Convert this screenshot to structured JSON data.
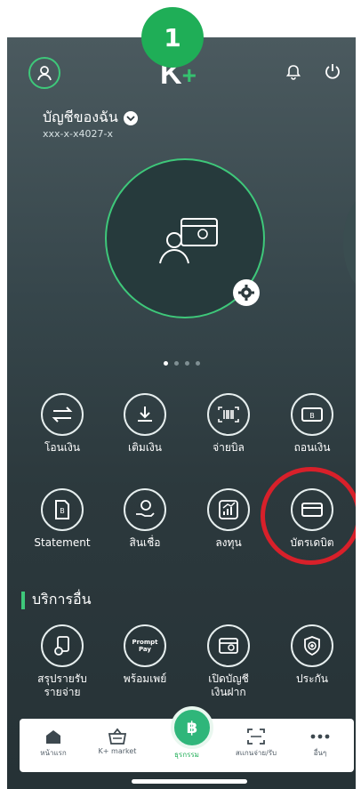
{
  "step_badge": "1",
  "header": {
    "logo_text": "K",
    "logo_plus": "+",
    "account_title": "บัญชีของฉัน",
    "account_number": "xxx-x-x4027-x"
  },
  "carousel": {
    "pages": 4,
    "active": 0
  },
  "menu_row1": [
    {
      "label": "โอนเงิน",
      "icon": "transfer-icon"
    },
    {
      "label": "เติมเงิน",
      "icon": "topup-icon"
    },
    {
      "label": "จ่ายบิล",
      "icon": "barcode-icon"
    },
    {
      "label": "ถอนเงิน",
      "icon": "withdraw-icon"
    }
  ],
  "menu_row2": [
    {
      "label": "Statement",
      "icon": "statement-icon"
    },
    {
      "label": "สินเชื่อ",
      "icon": "loan-icon"
    },
    {
      "label": "ลงทุน",
      "icon": "invest-icon"
    },
    {
      "label": "บัตรเดบิต",
      "icon": "debit-card-icon"
    }
  ],
  "other_services": {
    "title": "บริการอื่น",
    "items": [
      {
        "label_line1": "สรุปรายรับ",
        "label_line2": "รายจ่าย",
        "icon": "income-summary-icon"
      },
      {
        "label_line1": "พร้อมเพย์",
        "label_line2": "",
        "icon": "promptpay-icon",
        "icon_text": "Prompt Pay"
      },
      {
        "label_line1": "เปิดบัญชี",
        "label_line2": "เงินฝาก",
        "icon": "open-account-icon"
      },
      {
        "label_line1": "ประกัน",
        "label_line2": "",
        "icon": "insurance-icon"
      }
    ]
  },
  "bottom_nav": {
    "items": [
      {
        "label": "หน้าแรก",
        "icon": "home-icon"
      },
      {
        "label": "K+ market",
        "icon": "basket-icon"
      },
      {
        "label": "ธุรกรรม",
        "icon": "baht-icon"
      },
      {
        "label": "สแกนจ่าย/รับ",
        "icon": "scan-icon"
      },
      {
        "label": "อื่นๆ",
        "icon": "more-icon"
      }
    ],
    "center_symbol": "฿"
  },
  "colors": {
    "accent": "#3ec87a",
    "highlight": "#d8202a",
    "badge": "#1fae57"
  }
}
